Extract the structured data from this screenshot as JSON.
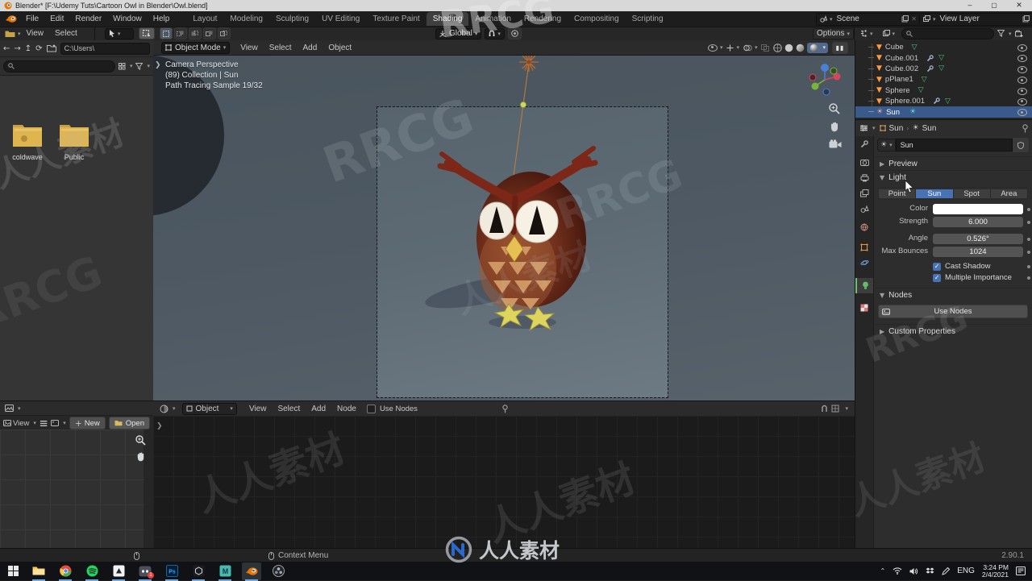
{
  "window": {
    "title": "Blender* [F:\\Udemy Tuts\\Cartoon Owl in Blender\\Owl.blend]",
    "minimize": "–",
    "maximize": "▢",
    "close": "✕"
  },
  "menubar": {
    "menus": [
      "File",
      "Edit",
      "Render",
      "Window",
      "Help"
    ],
    "tabs": [
      "Layout",
      "Modeling",
      "Sculpting",
      "UV Editing",
      "Texture Paint",
      "Shading",
      "Animation",
      "Rendering",
      "Compositing",
      "Scripting"
    ],
    "active_tab": "Shading",
    "scene_label": "Scene",
    "view_layer_label": "View Layer"
  },
  "tool_settings": {
    "orientation": "Global",
    "options": "Options"
  },
  "file_browser": {
    "menu_view": "View",
    "menu_select": "Select",
    "path": "C:\\Users\\",
    "folders": [
      "coldwave",
      "Public"
    ]
  },
  "viewport": {
    "mode": "Object Mode",
    "menus": [
      "View",
      "Select",
      "Add",
      "Object"
    ],
    "overlay": [
      "Camera Perspective",
      "(89) Collection | Sun",
      "Path Tracing Sample 19/32"
    ]
  },
  "outliner": {
    "items": [
      {
        "name": "Cube"
      },
      {
        "name": "Cube.001"
      },
      {
        "name": "Cube.002"
      },
      {
        "name": "pPlane1"
      },
      {
        "name": "Sphere"
      },
      {
        "name": "Sphere.001"
      },
      {
        "name": "Sun"
      }
    ],
    "selected_item": "Sun"
  },
  "properties": {
    "breadcrumb_object": "Sun",
    "breadcrumb_data": "Sun",
    "datablock_name": "Sun",
    "sections": {
      "preview": "Preview",
      "light": "Light",
      "nodes": "Nodes",
      "custom_properties": "Custom Properties"
    },
    "light": {
      "types": [
        "Point",
        "Sun",
        "Spot",
        "Area"
      ],
      "active_type": "Sun",
      "color_label": "Color",
      "color_value": "#ffffff",
      "strength_label": "Strength",
      "strength_value": "6.000",
      "angle_label": "Angle",
      "angle_value": "0.526°",
      "max_bounces_label": "Max Bounces",
      "max_bounces_value": "1024",
      "cast_shadow_label": "Cast Shadow",
      "cast_shadow_checked": true,
      "multiple_importance_label": "Multiple Importance",
      "multiple_importance_checked": true
    },
    "nodes": {
      "use_nodes_button": "Use Nodes"
    }
  },
  "shader_editor": {
    "shader_type": "Object",
    "menus": [
      "View",
      "Select",
      "Add",
      "Node"
    ],
    "use_nodes_label": "Use Nodes"
  },
  "image_editor": {
    "menu_view": "View",
    "new_button": "New",
    "open_button": "Open"
  },
  "status_bar": {
    "left_hint": "Context Menu",
    "version": "2.90.1"
  },
  "taskbar": {
    "language": "ENG",
    "time": "3:24 PM",
    "date": "2/4/2021"
  },
  "watermarks": {
    "rrcg": "RRCG",
    "rrsc": "人人素材"
  },
  "colors": {
    "accent_blue": "#4772b3",
    "selection_blue": "#3a5a8c",
    "blender_orange": "#ea7600",
    "folder_yellow": "#e2b44e"
  }
}
